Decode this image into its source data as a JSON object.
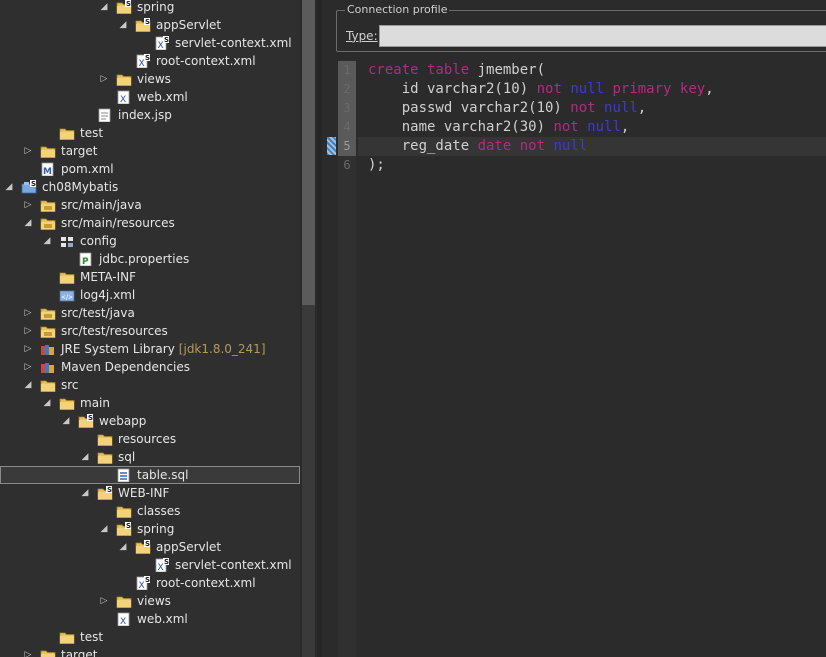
{
  "explorer": {
    "rows": [
      {
        "label": "spring",
        "icon": "folder-spring-icon",
        "twisty": "open"
      },
      {
        "label": "appServlet",
        "icon": "folder-spring-icon",
        "twisty": "open"
      },
      {
        "label": "servlet-context.xml",
        "icon": "spring-xml-icon",
        "twisty": ""
      },
      {
        "label": "root-context.xml",
        "icon": "spring-xml-icon",
        "twisty": ""
      },
      {
        "label": "views",
        "icon": "folder-icon",
        "twisty": "closed"
      },
      {
        "label": "web.xml",
        "icon": "xml-file-icon",
        "twisty": ""
      },
      {
        "label": "index.jsp",
        "icon": "jsp-file-icon",
        "twisty": ""
      },
      {
        "label": "test",
        "icon": "folder-icon",
        "twisty": ""
      },
      {
        "label": "target",
        "icon": "folder-icon",
        "twisty": "closed"
      },
      {
        "label": "pom.xml",
        "icon": "maven-pom-icon",
        "twisty": ""
      },
      {
        "label": "ch08Mybatis",
        "icon": "spring-project-icon",
        "twisty": "open"
      },
      {
        "label": "src/main/java",
        "icon": "source-folder-icon",
        "twisty": "closed"
      },
      {
        "label": "src/main/resources",
        "icon": "source-folder-icon",
        "twisty": "open"
      },
      {
        "label": "config",
        "icon": "package-icon",
        "twisty": "open"
      },
      {
        "label": "jdbc.properties",
        "icon": "properties-file-icon",
        "twisty": ""
      },
      {
        "label": "META-INF",
        "icon": "folder-icon",
        "twisty": ""
      },
      {
        "label": "log4j.xml",
        "icon": "xml-config-icon",
        "twisty": ""
      },
      {
        "label": "src/test/java",
        "icon": "source-folder-icon",
        "twisty": "closed"
      },
      {
        "label": "src/test/resources",
        "icon": "source-folder-icon",
        "twisty": "closed"
      },
      {
        "label": "JRE System Library",
        "icon": "library-icon",
        "twisty": "closed",
        "decoration": "[jdk1.8.0_241]"
      },
      {
        "label": "Maven Dependencies",
        "icon": "library-icon",
        "twisty": "closed"
      },
      {
        "label": "src",
        "icon": "folder-icon",
        "twisty": "open"
      },
      {
        "label": "main",
        "icon": "folder-icon",
        "twisty": "open"
      },
      {
        "label": "webapp",
        "icon": "folder-spring-icon",
        "twisty": "open"
      },
      {
        "label": "resources",
        "icon": "folder-icon",
        "twisty": ""
      },
      {
        "label": "sql",
        "icon": "folder-icon",
        "twisty": "open"
      },
      {
        "label": "table.sql",
        "icon": "sql-file-icon",
        "twisty": "",
        "selected": true
      },
      {
        "label": "WEB-INF",
        "icon": "folder-spring-icon",
        "twisty": "open"
      },
      {
        "label": "classes",
        "icon": "folder-icon",
        "twisty": ""
      },
      {
        "label": "spring",
        "icon": "folder-spring-icon",
        "twisty": "open"
      },
      {
        "label": "appServlet",
        "icon": "folder-spring-icon",
        "twisty": "open"
      },
      {
        "label": "servlet-context.xml",
        "icon": "spring-xml-icon",
        "twisty": ""
      },
      {
        "label": "root-context.xml",
        "icon": "spring-xml-icon",
        "twisty": ""
      },
      {
        "label": "views",
        "icon": "folder-icon",
        "twisty": "closed"
      },
      {
        "label": "web.xml",
        "icon": "xml-file-icon",
        "twisty": ""
      },
      {
        "label": "test",
        "icon": "folder-icon",
        "twisty": ""
      },
      {
        "label": "target",
        "icon": "folder-icon",
        "twisty": "closed"
      }
    ]
  },
  "editor": {
    "connection_profile": {
      "legend": "Connection profile",
      "type_label": "Type:",
      "type_value": ""
    },
    "line_numbers": [
      "1",
      "2",
      "3",
      "4",
      "5",
      "6"
    ],
    "lines": [
      [
        {
          "t": "create table",
          "c": "kw"
        },
        {
          "t": " jmember("
        }
      ],
      [
        {
          "t": "    id varchar2(10) "
        },
        {
          "t": "not",
          "c": "kw"
        },
        {
          "t": " "
        },
        {
          "t": "null",
          "c": "kn"
        },
        {
          "t": " "
        },
        {
          "t": "primary key",
          "c": "kw"
        },
        {
          "t": ","
        }
      ],
      [
        {
          "t": "    passwd varchar2(10) "
        },
        {
          "t": "not",
          "c": "kw"
        },
        {
          "t": " "
        },
        {
          "t": "null",
          "c": "kn"
        },
        {
          "t": ","
        }
      ],
      [
        {
          "t": "    name varchar2(30) "
        },
        {
          "t": "not",
          "c": "kw"
        },
        {
          "t": " "
        },
        {
          "t": "null",
          "c": "kn"
        },
        {
          "t": ","
        }
      ],
      [
        {
          "t": "    reg_date "
        },
        {
          "t": "date",
          "c": "kw"
        },
        {
          "t": " "
        },
        {
          "t": "not",
          "c": "kw"
        },
        {
          "t": " "
        },
        {
          "t": "null",
          "c": "kn"
        }
      ],
      [
        {
          "t": ");"
        }
      ]
    ],
    "current_line": 5
  },
  "colors": {
    "keyword": "#b32a84",
    "null_keyword": "#3d39d6",
    "text": "#d0d0d0",
    "background": "#2b2b2b"
  }
}
